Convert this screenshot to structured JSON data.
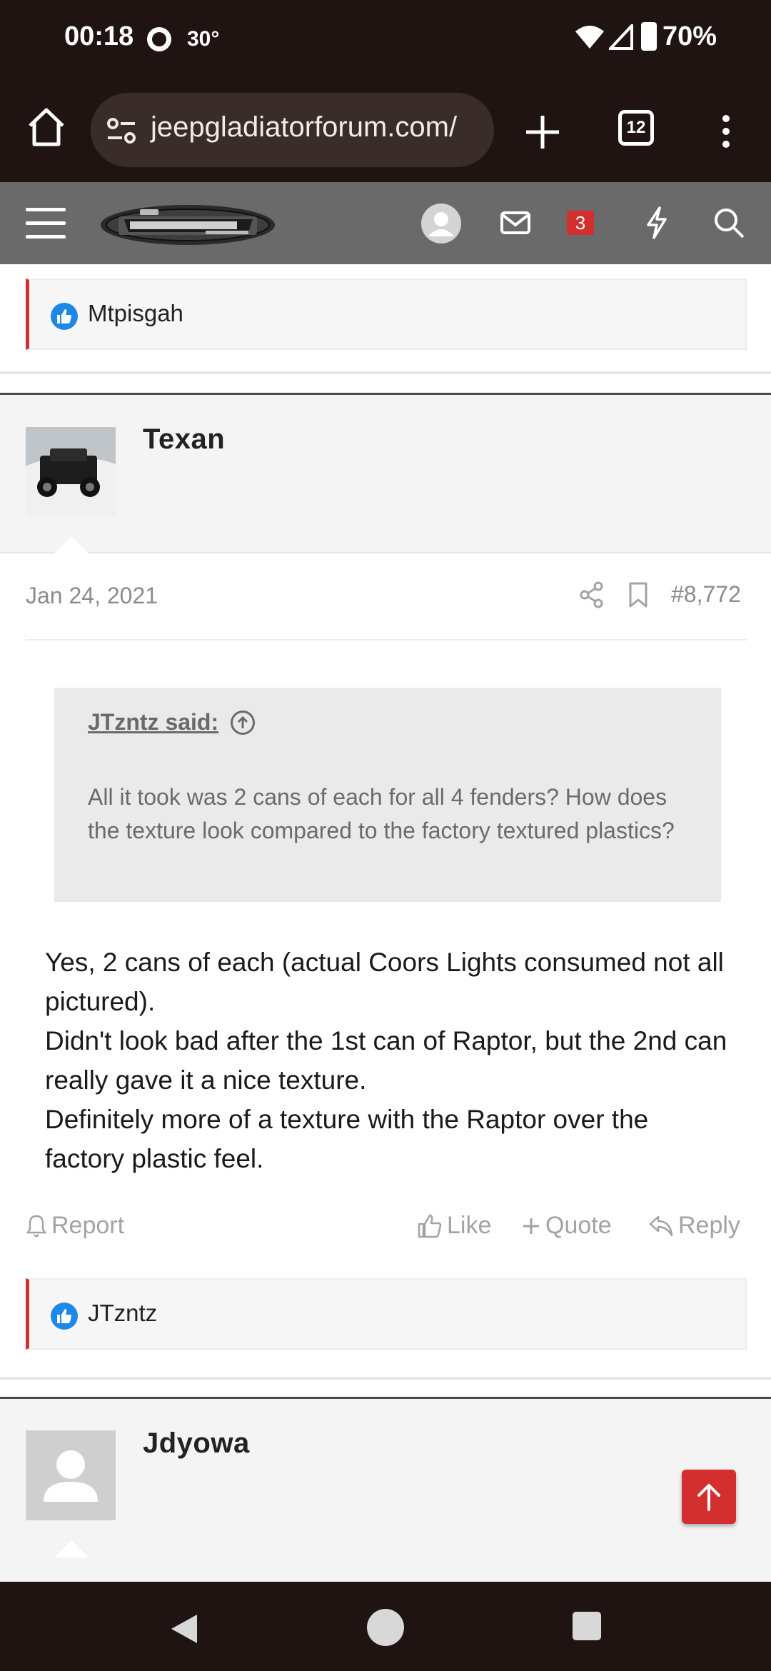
{
  "status_bar": {
    "time": "00:18",
    "temperature": "30°",
    "battery": "70%"
  },
  "browser": {
    "url": "jeepgladiatorforum.com/",
    "tab_count": "12"
  },
  "site_header": {
    "notification_count": "3"
  },
  "posts": [
    {
      "reactions": [
        "Mtpisgah"
      ]
    },
    {
      "username": "Texan",
      "date": "Jan 24, 2021",
      "post_number": "#8,772",
      "quote": {
        "author": "JTzntz said:",
        "text": "All it took was 2 cans of each for all 4 fenders? How does the texture look compared to the factory textured plastics?"
      },
      "body": [
        "Yes, 2 cans of each (actual Coors Lights consumed not all pictured).",
        "Didn't look bad after the 1st can of Raptor, but the 2nd can really gave it a nice texture.",
        "Definitely more of a texture with the Raptor over the factory plastic feel."
      ],
      "actions": {
        "report": "Report",
        "like": "Like",
        "quote": "Quote",
        "reply": "Reply"
      },
      "reactions": [
        "JTzntz"
      ]
    },
    {
      "username": "Jdyowa"
    }
  ],
  "colors": {
    "accent_red": "#d32f2f",
    "like_blue": "#1e88e5",
    "header_gray": "#6a6a6a",
    "chrome_dark": "#1f1412"
  }
}
